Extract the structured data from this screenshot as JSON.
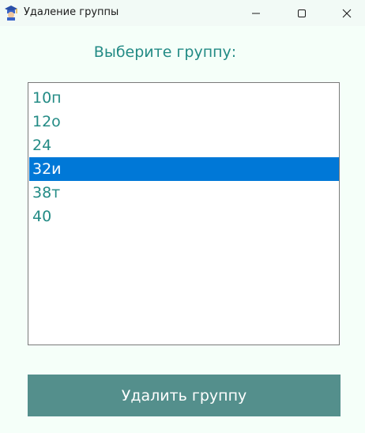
{
  "window": {
    "title": "Удаление группы",
    "icon": "graduation-cap-icon",
    "controls": {
      "minimize_icon": "minimize-icon",
      "maximize_icon": "maximize-icon",
      "close_icon": "close-icon"
    }
  },
  "main": {
    "prompt": "Выберите группу:",
    "groups": [
      "10п",
      "12о",
      "24",
      "32и",
      "38т",
      "40"
    ],
    "selected_group": "32и",
    "delete_button_label": "Удалить группу"
  },
  "colors": {
    "background": "#f5fff9",
    "text_accent": "#238b85",
    "selection": "#0078d7",
    "button": "#548f8c"
  }
}
